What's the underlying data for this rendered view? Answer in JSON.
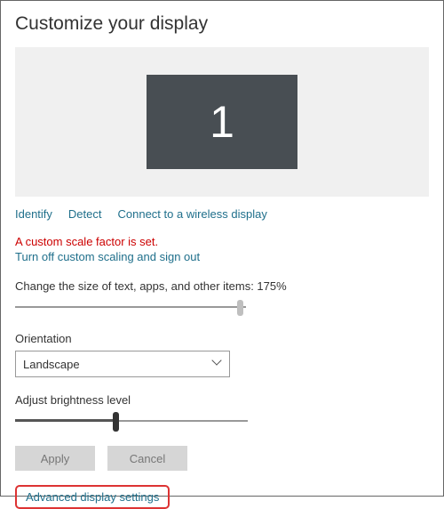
{
  "title": "Customize your display",
  "preview": {
    "monitor_number": "1"
  },
  "links": {
    "identify": "Identify",
    "detect": "Detect",
    "wireless": "Connect to a wireless display"
  },
  "scale_warning": "A custom scale factor is set.",
  "turn_off_scaling": "Turn off custom scaling and sign out",
  "size_label": "Change the size of text, apps, and other items: 175%",
  "size_slider": {
    "percent": 96
  },
  "orientation": {
    "label": "Orientation",
    "value": "Landscape"
  },
  "brightness": {
    "label": "Adjust brightness level",
    "percent": 42
  },
  "buttons": {
    "apply": "Apply",
    "cancel": "Cancel"
  },
  "advanced_link": "Advanced display settings"
}
